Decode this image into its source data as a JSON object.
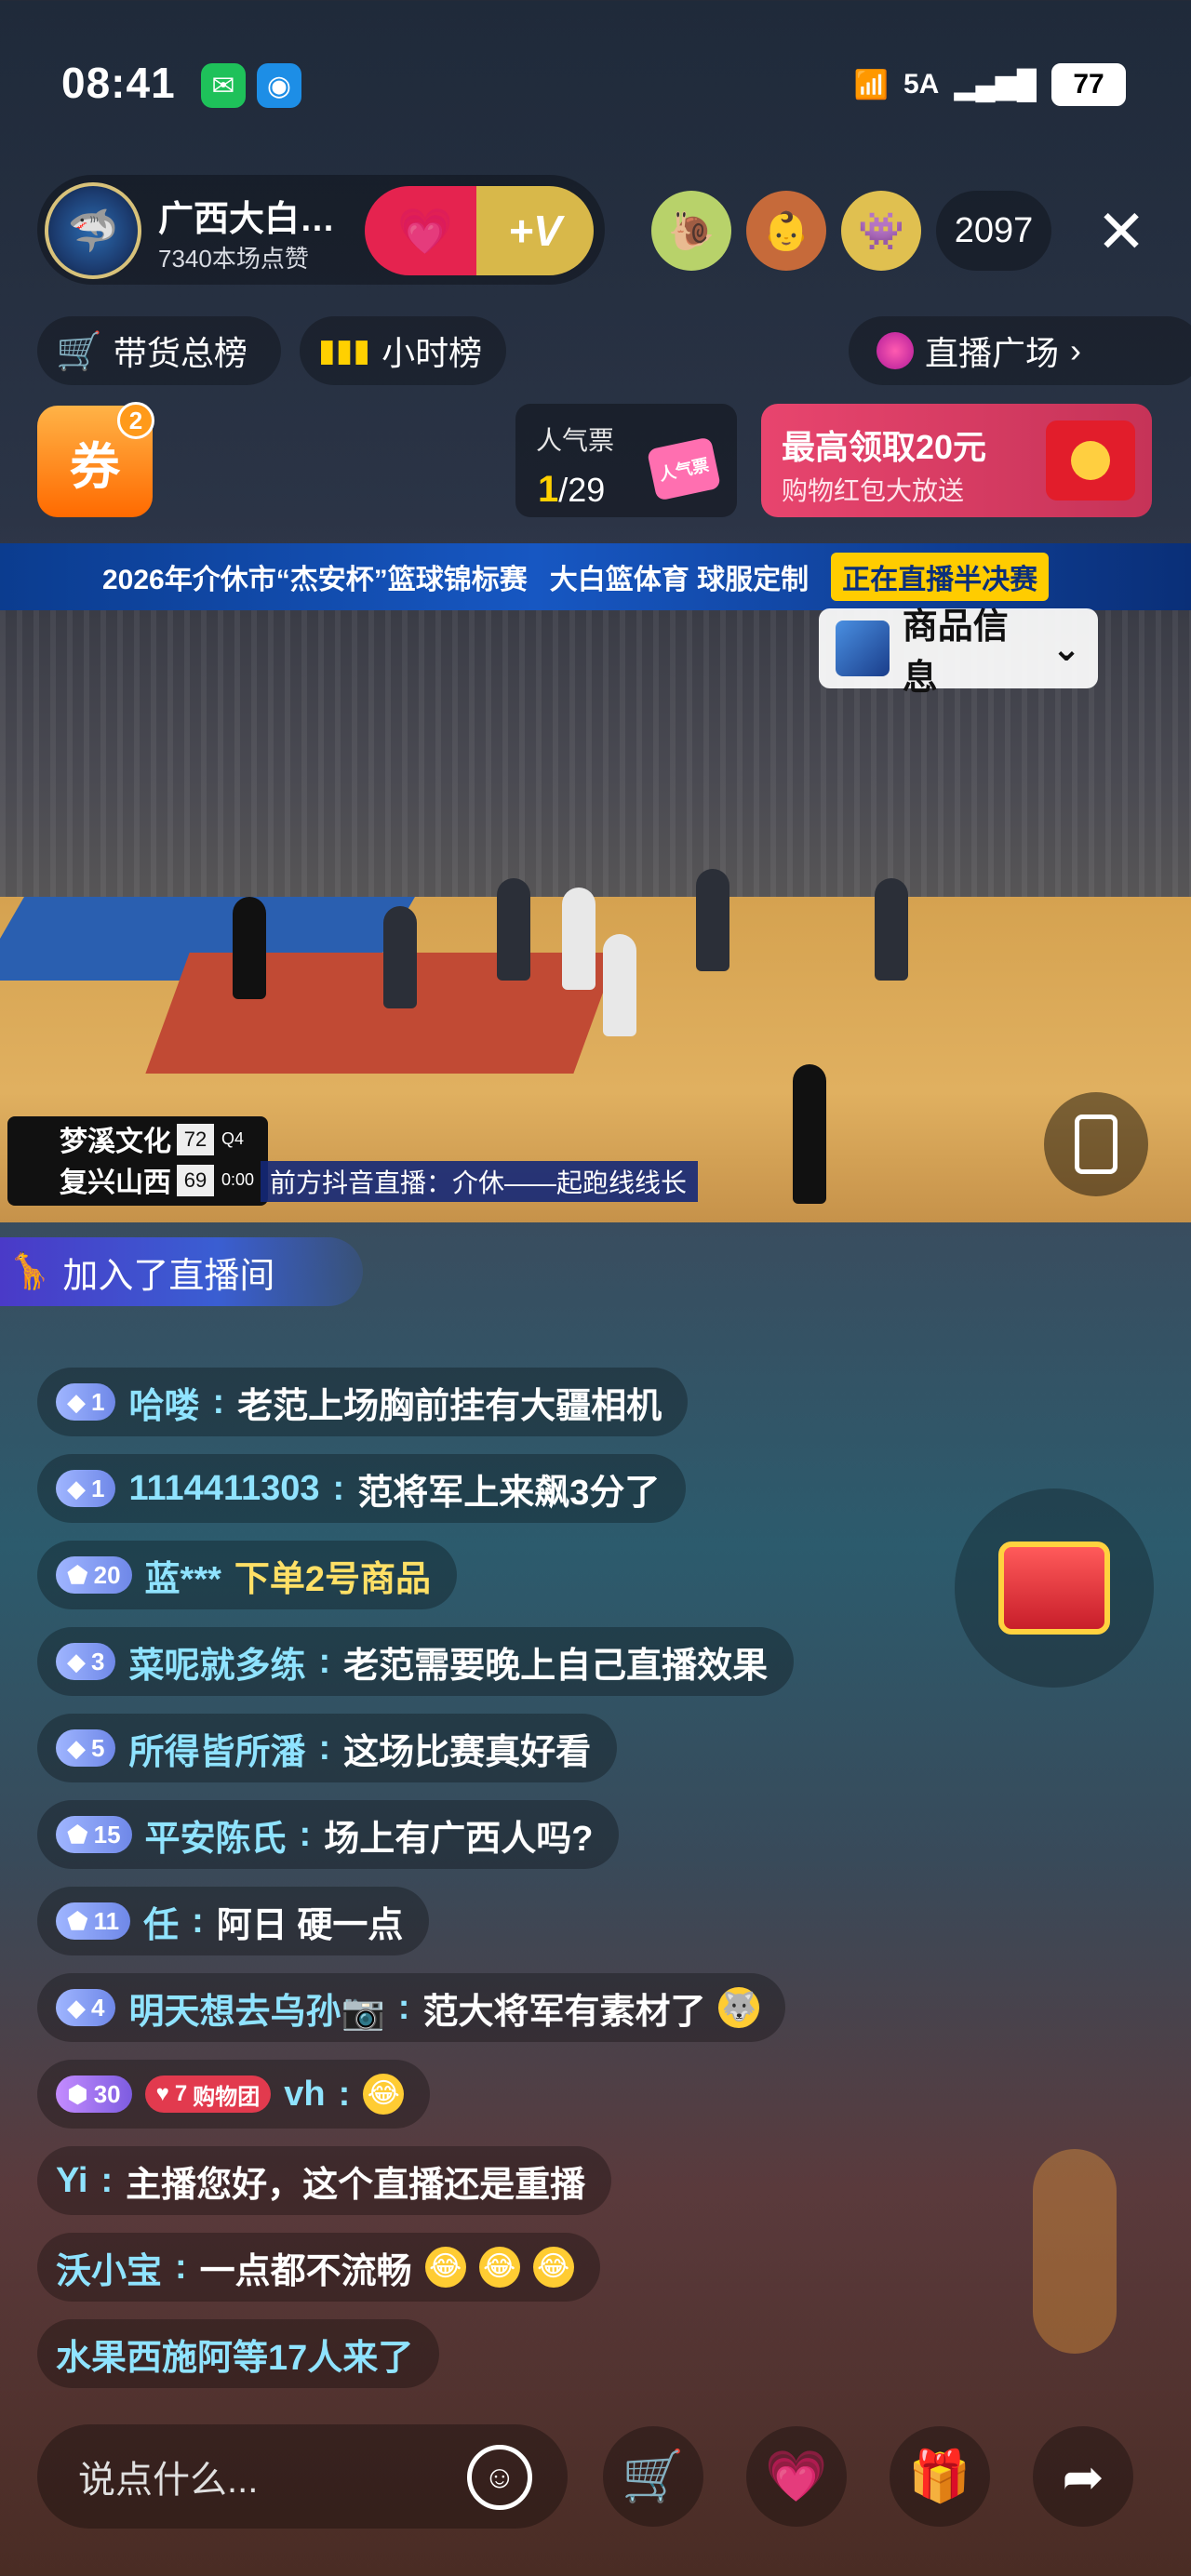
{
  "status": {
    "time": "08:41",
    "network": "5A",
    "battery": "77"
  },
  "host": {
    "name": "广西大白…",
    "likes": "7340本场点赞",
    "vip_label": "+V"
  },
  "viewers": {
    "count": "2097"
  },
  "ranks": {
    "sales": "带货总榜",
    "hourly": "小时榜",
    "plaza": "直播广场"
  },
  "coupon": {
    "label": "券",
    "badge": "2"
  },
  "popularity": {
    "title": "人气票",
    "rank": "1",
    "total": "/29",
    "ticket_text": "人气票"
  },
  "redpacket": {
    "title": "最高领取20元",
    "subtitle": "购物红包大放送"
  },
  "video": {
    "banner_left": "2026年介休市“杰安杯”篮球锦标赛",
    "banner_sponsor": "大白篮体育 球服定制",
    "banner_live": "正在直播半决赛",
    "product_info": "商品信息",
    "teams": [
      {
        "name": "梦溪文化",
        "score": "72",
        "period": "Q4"
      },
      {
        "name": "复兴山西",
        "score": "69",
        "clock": "0:00"
      }
    ],
    "ticker": "前方抖音直播：介休——起跑线线长"
  },
  "joined": "加入了直播间",
  "messages": [
    {
      "level": "1",
      "user": "哈喽",
      "text": "老范上场胸前挂有大疆相机"
    },
    {
      "level": "1",
      "user": "1114411303",
      "text": "范将军上来飙3分了"
    },
    {
      "level": "20",
      "user": "蓝***",
      "text": "下单2号商品"
    },
    {
      "level": "3",
      "user": "菜呢就多练",
      "text": "老范需要晚上自己直播效果"
    },
    {
      "level": "5",
      "user": "所得皆所潘",
      "text": "这场比赛真好看"
    },
    {
      "level": "15",
      "user": "平安陈氏",
      "text": "场上有广西人吗?"
    },
    {
      "level": "11",
      "user": "任",
      "text": "阿日 硬一点"
    },
    {
      "level": "4",
      "user": "明天想去乌孙📷",
      "text": "范大将军有素材了"
    },
    {
      "level": "30",
      "group": "7",
      "group_label": "购物团",
      "user": "vh",
      "text": ""
    },
    {
      "user": "Yi",
      "text": "主播您好，这个直播还是重播"
    },
    {
      "user": "沃小宝",
      "text": "一点都不流畅"
    },
    {
      "text": "水果西施阿等17人来了"
    }
  ],
  "input": {
    "placeholder": "说点什么..."
  },
  "icons": {
    "wechat": "wechat-icon",
    "browser": "browser-icon",
    "close": "close-icon",
    "cart": "cart-icon",
    "bars": "bar-chart-icon",
    "chevron": "chevron-right-icon",
    "treasure": "treasure-chest-icon",
    "emoji": "emoji-icon",
    "heart": "heart-icon",
    "gift": "gift-icon",
    "share": "share-icon"
  }
}
